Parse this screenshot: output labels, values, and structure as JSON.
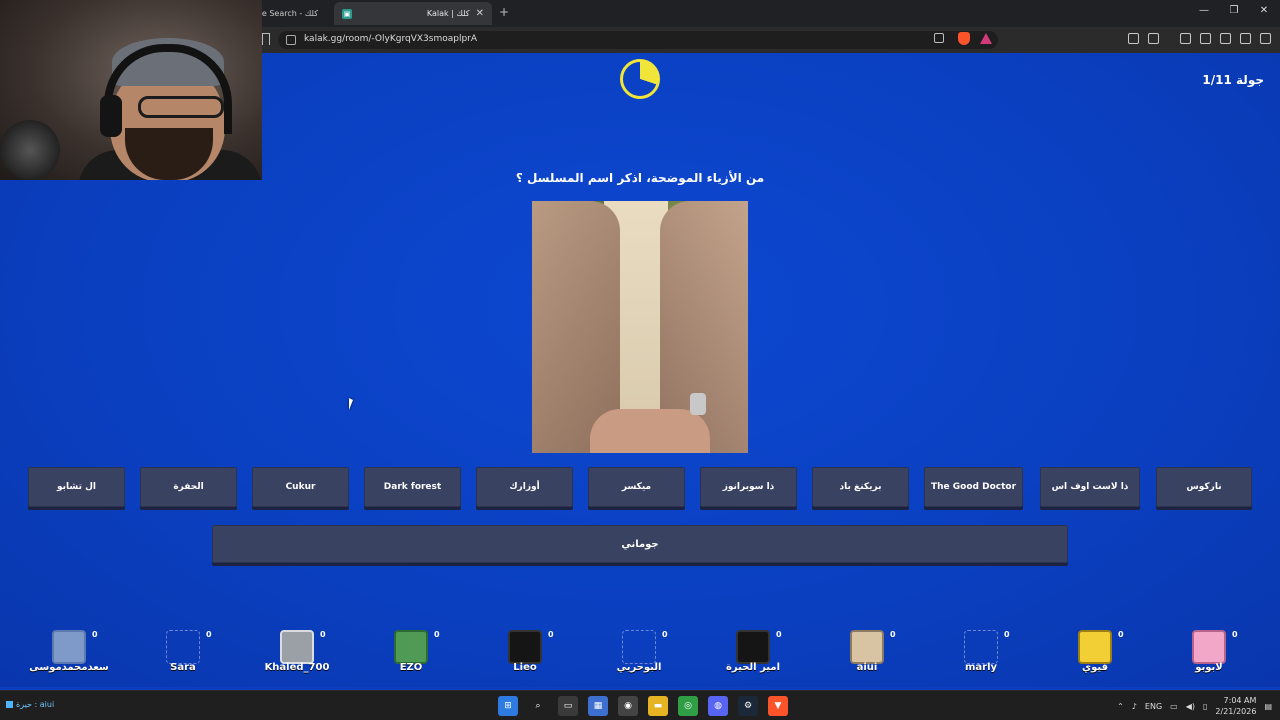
{
  "browser": {
    "tab1_label": "ogle Search - كلك",
    "tab2_label": "Kalak | كلك",
    "url": "kalak.gg/room/-OlyKgrqVX3smoaplprA"
  },
  "game": {
    "round_label": "جولة",
    "round_value": "1/11",
    "question": "من الأزياء الموضحة، اذكر اسم المسلسل ؟",
    "timer_fraction": 0.3,
    "answers": [
      "ال تشابو",
      "الحفرة",
      "Cukur",
      "Dark forest",
      "أوزارك",
      "ميكسر",
      "ذا سوبرانوز",
      "بريكنغ باد",
      "The Good Doctor",
      "ذا لاست اوف اس",
      "ناركوس"
    ],
    "wide_answer": "جوماني",
    "players": [
      {
        "name": "سعدمحمدموسى",
        "score": "0",
        "avatar": "blue"
      },
      {
        "name": "Sara",
        "score": "0",
        "avatar": "empty"
      },
      {
        "name": "Khaled_700",
        "score": "0",
        "avatar": "tv"
      },
      {
        "name": "EZO",
        "score": "0",
        "avatar": "green"
      },
      {
        "name": "Lieo",
        "score": "0",
        "avatar": "dark"
      },
      {
        "name": "البوحريي",
        "score": "0",
        "avatar": "empty"
      },
      {
        "name": "امير الحيرة",
        "score": "0",
        "avatar": "dark"
      },
      {
        "name": "aiui",
        "score": "0",
        "avatar": "beige"
      },
      {
        "name": "marly",
        "score": "0",
        "avatar": "empty"
      },
      {
        "name": "فيوي",
        "score": "0",
        "avatar": "yellow"
      },
      {
        "name": "لابوبو",
        "score": "0",
        "avatar": "pink"
      }
    ]
  },
  "taskbar": {
    "left_text": "حيرة : aiui",
    "lang": "ENG",
    "time": "7:04 AM",
    "date": "2/21/2026"
  }
}
